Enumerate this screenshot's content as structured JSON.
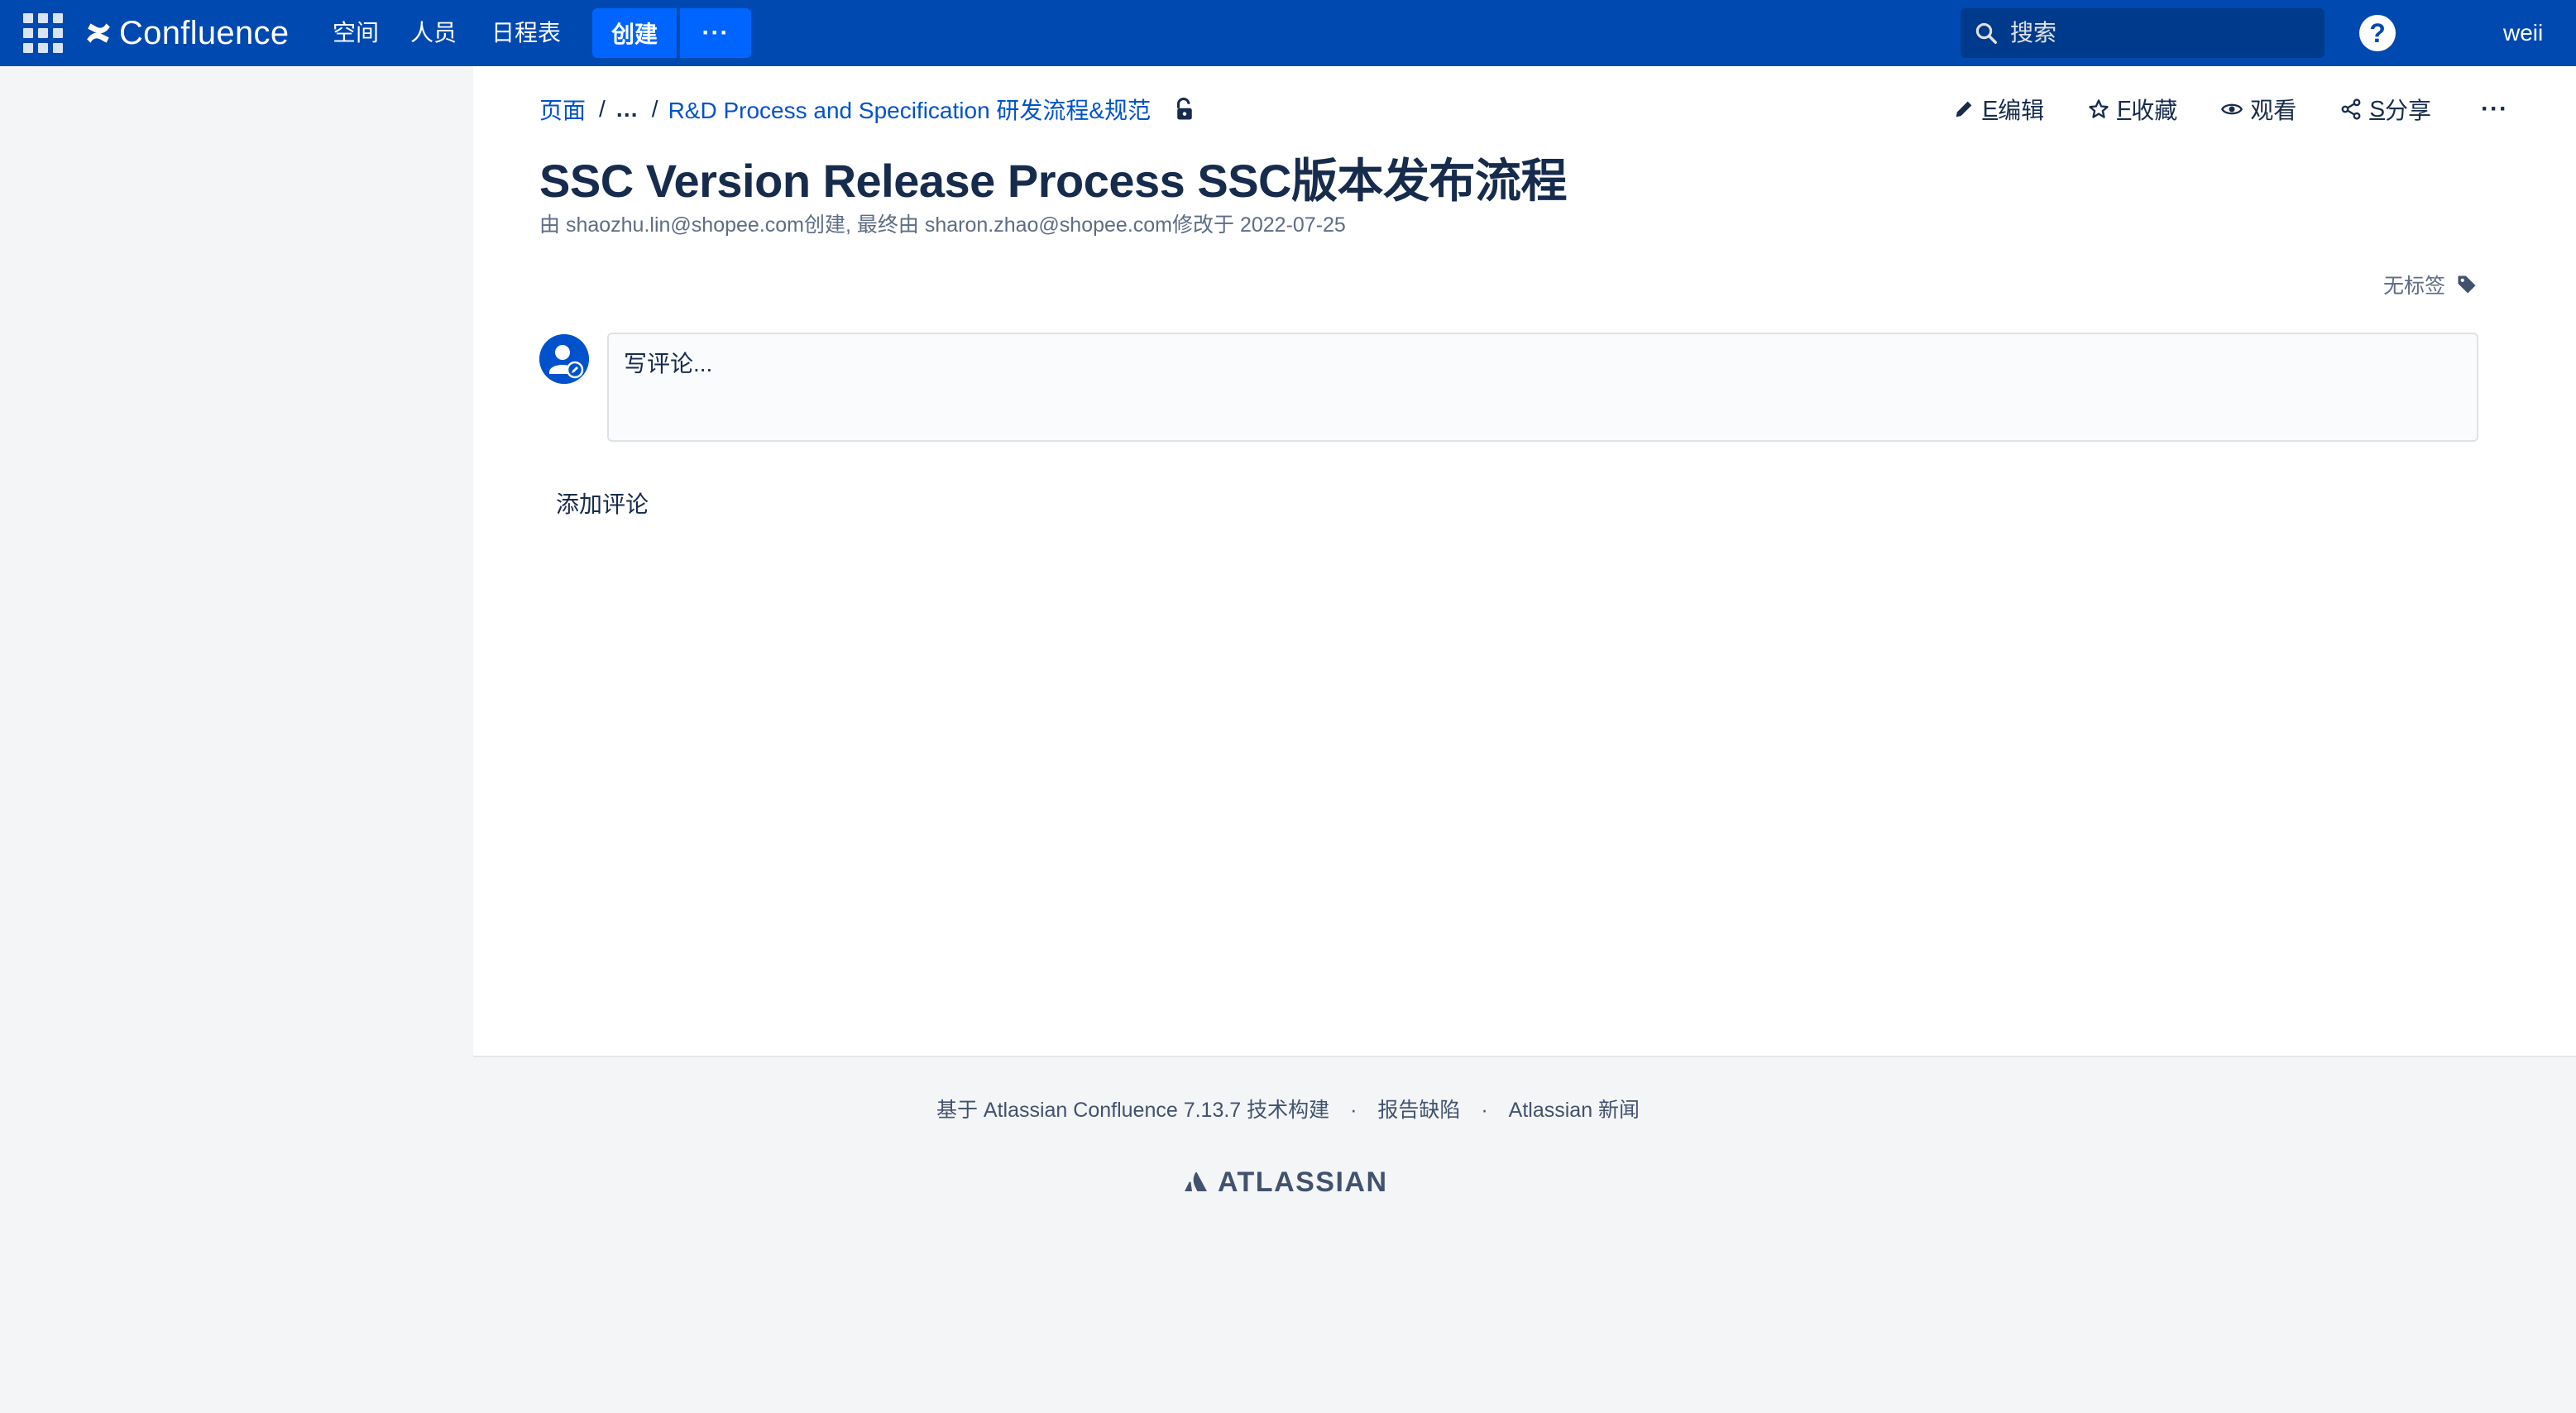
{
  "nav": {
    "product": "Confluence",
    "links": [
      "空间",
      "人员",
      "日程表"
    ],
    "create_label": "创建",
    "more_label": "···",
    "search_placeholder": "搜索",
    "help_label": "?",
    "user": "weii"
  },
  "breadcrumb": {
    "root": "页面",
    "ellipsis": "…",
    "parent": "R&D Process and Specification 研发流程&规范"
  },
  "actions": {
    "edit_key": "E",
    "edit_label": "编辑",
    "star_key": "F",
    "star_label": "收藏",
    "watch_label": "观看",
    "share_key": "S",
    "share_label": "分享",
    "more_label": "···"
  },
  "page": {
    "title": "SSC Version Release Process SSC版本发布流程",
    "byline": "由 shaozhu.lin@shopee.com创建, 最终由 sharon.zhao@shopee.com修改于 2022-07-25",
    "labels_text": "无标签"
  },
  "comments": {
    "placeholder": "写评论...",
    "add_label": "添加评论"
  },
  "footer": {
    "built_on": "基于 Atlassian Confluence 7.13.7 技术构建",
    "separator": "·",
    "report_bug": "报告缺陷",
    "news": "Atlassian 新闻",
    "brand": "ATLASSIAN"
  },
  "colors": {
    "nav_bg": "#0049b0",
    "button_blue": "#0065ff",
    "link": "#0052cc",
    "text": "#172b4d",
    "muted": "#5e6c84",
    "page_bg": "#f4f5f7"
  }
}
